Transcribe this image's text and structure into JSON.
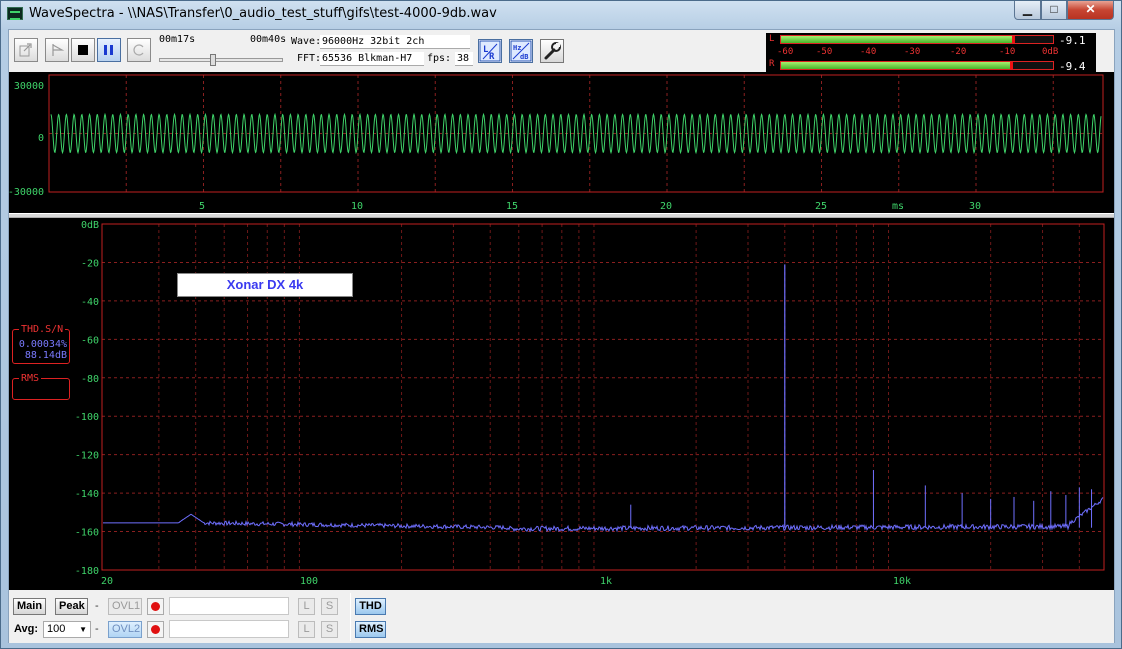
{
  "window": {
    "title": "WaveSpectra - \\\\NAS\\Transfer\\0_audio_test_stuff\\gifs\\test-4000-9db.wav",
    "min_glyph": "▁",
    "max_glyph": "□",
    "close_glyph": "✕"
  },
  "toolbar": {
    "time_position": "00m17s",
    "time_total": "00m40s",
    "playback_progress": 0.425,
    "wave_label": "Wave:",
    "wave_value": "96000Hz 32bit 2ch",
    "fft_label": "FFT:",
    "fft_value": "65536 Blkman-H7",
    "fps_label": "fps:",
    "fps_value": "38",
    "lr_button": "LR",
    "hz_button": "Hz dB"
  },
  "level_meter": {
    "left_label": "L",
    "right_label": "R",
    "left_value": "-9.1",
    "right_value": "-9.4",
    "left_level_db": -9.1,
    "right_level_db": -9.4,
    "scale": [
      "-60",
      "-50",
      "-40",
      "-30",
      "-20",
      "-10",
      "0dB"
    ],
    "colors": {
      "bar": "#47b52a",
      "peak": "#e11111",
      "scale": "#e33333"
    }
  },
  "waveform": {
    "y_ticks": [
      "30000",
      "0",
      "-30000"
    ],
    "x_ticks": [
      "5",
      "10",
      "15",
      "20",
      "25",
      "30"
    ],
    "x_unit": "ms",
    "frequency_hz": 4000,
    "amplitude": 10600,
    "color": "#3fd46a"
  },
  "spectrum": {
    "y_ticks": [
      "0dB",
      "-20",
      "-40",
      "-60",
      "-80",
      "-100",
      "-120",
      "-140",
      "-160",
      "-180"
    ],
    "x_ticks": [
      "20",
      "100",
      "1k",
      "10k"
    ],
    "fundamental_hz": 4000,
    "fundamental_db": -21,
    "noise_floor_db": -157,
    "color": "#6f6fff",
    "annotation": "Xonar DX 4k",
    "thd_title": "THD.S/N",
    "thd_value": "0.00034%",
    "snr_value": "88.14dB",
    "rms_title": "RMS"
  },
  "bottom": {
    "main_button": "Main",
    "peak_button": "Peak",
    "dash": "-",
    "ovl1": "OVL1",
    "ovl2": "OVL2",
    "l_button": "L",
    "s_button": "S",
    "avg_label": "Avg:",
    "avg_value": "100",
    "thd_button": "THD",
    "rms_button": "RMS"
  }
}
